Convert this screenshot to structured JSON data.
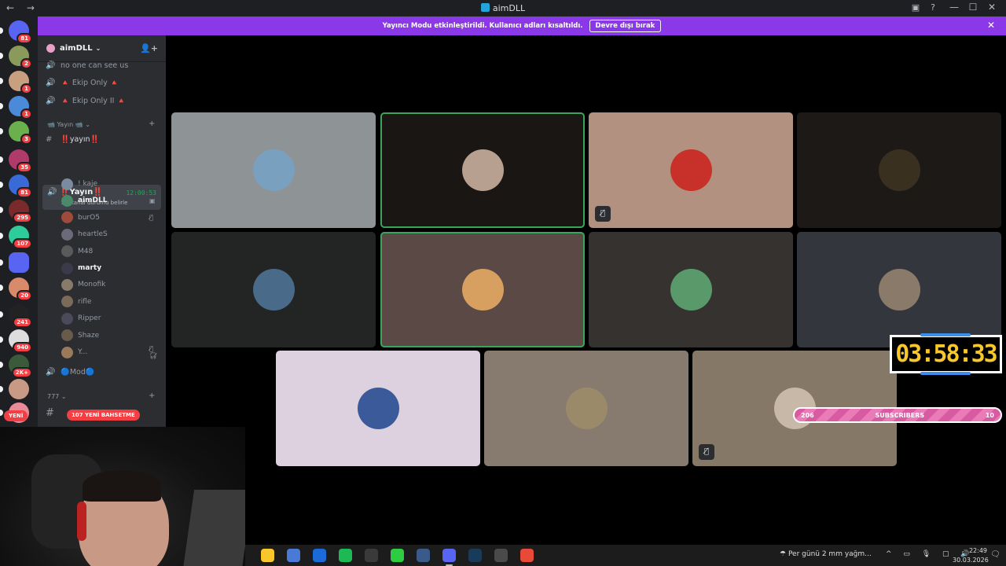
{
  "window": {
    "title": "aimDLL",
    "nav_arrows": "←  →",
    "controls": [
      "—",
      "☐",
      "✕"
    ]
  },
  "banner": {
    "text": "Yayıncı Modu etkinleştirildi. Kullanıcı adları kısaltıldı.",
    "button": "Devre dışı bırak",
    "close": "✕"
  },
  "guilds": [
    {
      "badge": "81",
      "color": "#5865f2"
    },
    {
      "badge": "2",
      "color": "#8a9a5b"
    },
    {
      "badge": "1",
      "color": "#c8a080"
    },
    {
      "badge": "1",
      "color": "#4a8ad8"
    },
    {
      "badge": "3",
      "color": "#6ab04c"
    },
    {
      "badge": "35",
      "color": "#b03a6a"
    },
    {
      "badge": "81",
      "color": "#3a6ad8"
    },
    {
      "badge": "295",
      "color": "#7a2a2a"
    },
    {
      "badge": "107",
      "color": "#2ecc9a"
    },
    {
      "badge": "",
      "color": "#5865f2"
    },
    {
      "badge": "20",
      "color": "#d88a6a"
    },
    {
      "badge": "241",
      "color": "#222222"
    },
    {
      "badge": "940",
      "color": "#dddddd"
    },
    {
      "badge": "2K+",
      "color": "#3a5a3a"
    },
    {
      "badge": "",
      "color": "#c89a86"
    },
    {
      "badge": "",
      "color": "#e88a9a"
    }
  ],
  "new_label": "YENİ",
  "server": {
    "name": "aimDLL",
    "channels_top": [
      {
        "name": "no one can see us"
      },
      {
        "name": "🔺 Ekip Only 🔺"
      },
      {
        "name": "🔺 Ekip Only II 🔺"
      }
    ],
    "category_stream": "📹 Yayın 📹",
    "text_channel": "‼️yayın‼️",
    "active_voice": {
      "name": "‼️Yayın‼️",
      "status": "Bir kanal durumu belirle",
      "timer": "12:00:53"
    },
    "members": [
      {
        "name": "! kaje",
        "bright": false,
        "mic": ""
      },
      {
        "name": "aimDLL",
        "bright": true,
        "mic": "▣"
      },
      {
        "name": "burO5",
        "bright": false,
        "mic": "🎙̸"
      },
      {
        "name": "heartleS",
        "bright": false,
        "mic": ""
      },
      {
        "name": "M48",
        "bright": false,
        "mic": ""
      },
      {
        "name": "marty",
        "bright": true,
        "mic": ""
      },
      {
        "name": "Monofik",
        "bright": false,
        "mic": ""
      },
      {
        "name": "rifle",
        "bright": false,
        "mic": ""
      },
      {
        "name": "Ripper",
        "bright": false,
        "mic": ""
      },
      {
        "name": "Shaze",
        "bright": false,
        "mic": ""
      },
      {
        "name": "Y...",
        "bright": false,
        "mic": "🎙̸ 🎧̸"
      }
    ],
    "mod_channel": "🔵Mod🔵",
    "category_777": "777",
    "mention_label": "107 YENİ BAHSETME"
  },
  "tiles": [
    {
      "bg": "#8e9396",
      "avatar": "#7aa0c0",
      "speaking": false,
      "muted": false
    },
    {
      "bg": "#1a1614",
      "avatar": "#b8a090",
      "speaking": true,
      "muted": false
    },
    {
      "bg": "#b39180",
      "avatar": "#c8302a",
      "speaking": false,
      "muted": true
    },
    {
      "bg": "#1c1917",
      "avatar": "#3a3020",
      "speaking": false,
      "muted": false
    },
    {
      "bg": "#222524",
      "avatar": "#4a6a8a",
      "speaking": false,
      "muted": false
    },
    {
      "bg": "#5a4945",
      "avatar": "#d8a060",
      "speaking": true,
      "muted": false
    },
    {
      "bg": "#363230",
      "avatar": "#5a9a6a",
      "speaking": false,
      "muted": false
    },
    {
      "bg": "#33373d",
      "avatar": "#8a7a6a",
      "speaking": false,
      "muted": false
    },
    {
      "bg": "#ddd0df",
      "avatar": "#3a5a9a",
      "speaking": false,
      "muted": false
    },
    {
      "bg": "#877a6e",
      "avatar": "#9a8a6a",
      "speaking": false,
      "muted": false
    },
    {
      "bg": "#857866",
      "avatar": "#c8b8a8",
      "speaking": false,
      "muted": true
    }
  ],
  "overlay": {
    "timer": "03:58:33",
    "subs_left": "206",
    "subs_label": "SUBSCRIBERS",
    "subs_right": "10"
  },
  "taskbar": {
    "apps": [
      {
        "color": "#f7c72b"
      },
      {
        "color": "#4a7ad8"
      },
      {
        "color": "#1a6ad8"
      },
      {
        "color": "#1db954"
      },
      {
        "color": "#3a3a3a"
      },
      {
        "color": "#2ecc40"
      },
      {
        "color": "#3a5a8a"
      },
      {
        "color": "#5865f2"
      },
      {
        "color": "#1a3a5a"
      },
      {
        "color": "#4a4a4a"
      },
      {
        "color": "#e84a3a"
      }
    ],
    "weather": "Per günü 2 mm yağm...",
    "tray": "^ ▭ 🎙 ▢ 🔊",
    "time": "22:49",
    "date": "30.03.2026",
    "notif": "🗨"
  }
}
